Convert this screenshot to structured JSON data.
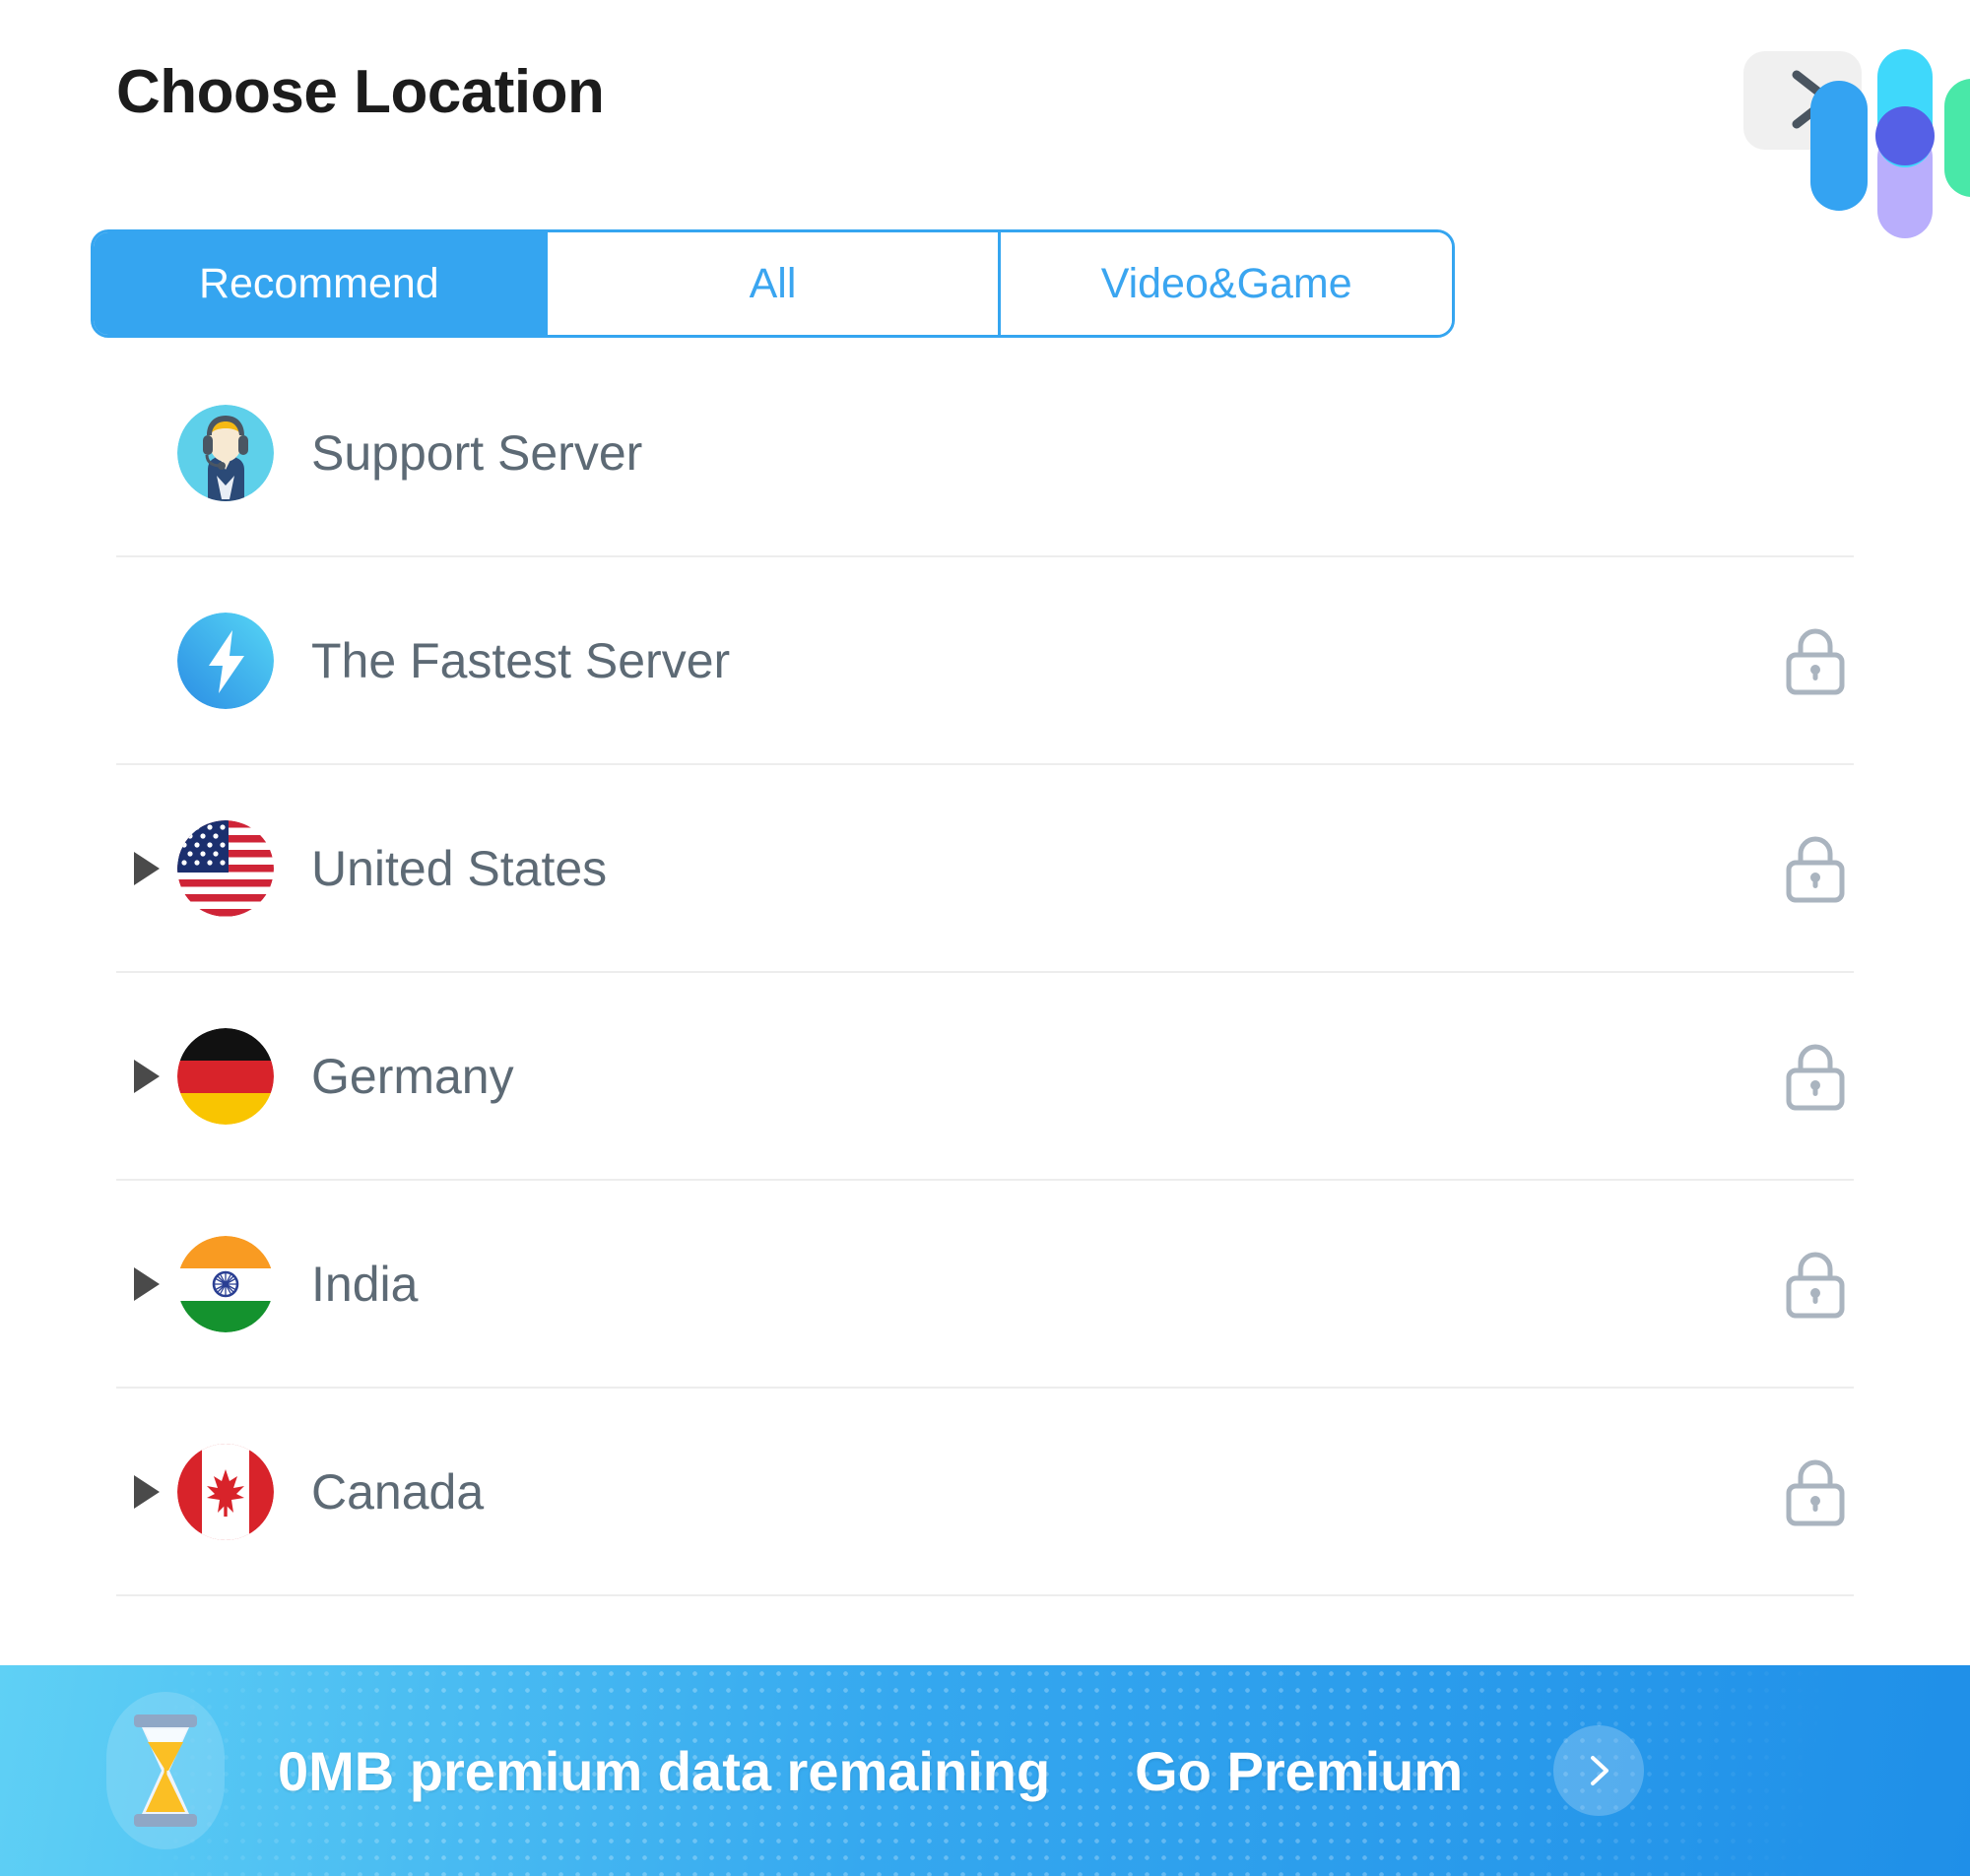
{
  "header": {
    "title": "Choose Location",
    "logo": {
      "chevron_icon": "chevron-right-icon",
      "bar_colors": [
        "#34a3f2",
        "#3fd8fb",
        "#b9aefc",
        "#5560e6",
        "#49e8a8"
      ]
    }
  },
  "tabs": [
    {
      "label": "Recommend",
      "active": true
    },
    {
      "label": "All",
      "active": false
    },
    {
      "label": "Video&Game",
      "active": false
    }
  ],
  "tab_colors": {
    "accent": "#35a5f0",
    "active_text": "#ffffff",
    "inactive_text": "#3aa5f0"
  },
  "servers": [
    {
      "label": "Support Server",
      "icon": "headset-avatar-icon",
      "expandable": false,
      "locked": false
    },
    {
      "label": "The Fastest Server",
      "icon": "lightning-bolt-icon",
      "expandable": false,
      "locked": true
    },
    {
      "label": "United States",
      "icon": "flag-us-icon",
      "expandable": true,
      "locked": true
    },
    {
      "label": "Germany",
      "icon": "flag-de-icon",
      "expandable": true,
      "locked": true
    },
    {
      "label": "India",
      "icon": "flag-in-icon",
      "expandable": true,
      "locked": true
    },
    {
      "label": "Canada",
      "icon": "flag-ca-icon",
      "expandable": true,
      "locked": true
    }
  ],
  "banner": {
    "icon": "hourglass-icon",
    "status_text": "0MB premium data remaining",
    "cta_label": "Go Premium",
    "arrow_icon": "chevron-right-icon",
    "gradient_from": "#5fd0f5",
    "gradient_to": "#1f8fe8"
  }
}
